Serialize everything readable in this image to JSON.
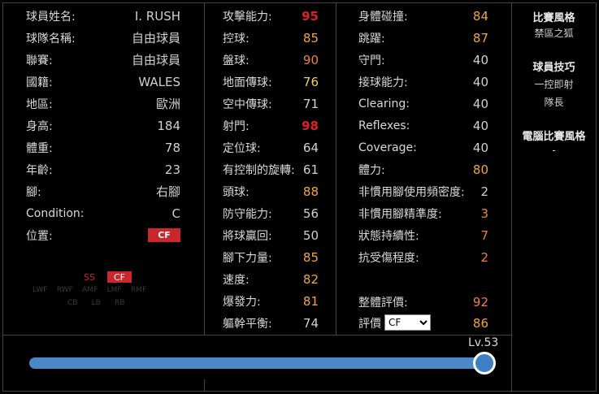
{
  "profile": [
    {
      "label": "球員姓名:",
      "value": "I. RUSH"
    },
    {
      "label": "球隊名稱:",
      "value": "自由球員"
    },
    {
      "label": "聯賽:",
      "value": "自由球員"
    },
    {
      "label": "國籍:",
      "value": "WALES"
    },
    {
      "label": "地區:",
      "value": "歐洲"
    },
    {
      "label": "身高:",
      "value": "184"
    },
    {
      "label": "體重:",
      "value": "78"
    },
    {
      "label": "年齡:",
      "value": "23"
    },
    {
      "label": "腳:",
      "value": "右腳"
    },
    {
      "label": "Condition:",
      "value": "C"
    },
    {
      "label": "位置:",
      "value": "CF"
    }
  ],
  "position_map": {
    "tags": [
      "SS",
      "CF"
    ],
    "faint_row1": [
      "LWF",
      "RWF",
      "AMF",
      "LMF",
      "RMF"
    ],
    "faint_row2": [
      "CB",
      "LB",
      "RB"
    ]
  },
  "stats_col2": [
    {
      "label": "攻擊能力:",
      "value": "95",
      "tier": "top"
    },
    {
      "label": "控球:",
      "value": "85",
      "tier": "high"
    },
    {
      "label": "盤球:",
      "value": "90",
      "tier": "low"
    },
    {
      "label": "地面傳球:",
      "value": "76",
      "tier": "mid"
    },
    {
      "label": "空中傳球:",
      "value": "71",
      "tier": "normal"
    },
    {
      "label": "射門:",
      "value": "98",
      "tier": "top"
    },
    {
      "label": "定位球:",
      "value": "64",
      "tier": "normal"
    },
    {
      "label": "有控制的旋轉:",
      "value": "61",
      "tier": "normal"
    },
    {
      "label": "頭球:",
      "value": "88",
      "tier": "high"
    },
    {
      "label": "防守能力:",
      "value": "56",
      "tier": "normal"
    },
    {
      "label": "將球贏回:",
      "value": "50",
      "tier": "normal"
    },
    {
      "label": "腳下力量:",
      "value": "85",
      "tier": "high"
    },
    {
      "label": "速度:",
      "value": "82",
      "tier": "high"
    },
    {
      "label": "爆發力:",
      "value": "81",
      "tier": "high"
    },
    {
      "label": "軀幹平衡:",
      "value": "74",
      "tier": "normal"
    }
  ],
  "stats_col3": [
    {
      "label": "身體碰撞:",
      "value": "84",
      "tier": "high"
    },
    {
      "label": "跳躍:",
      "value": "87",
      "tier": "high"
    },
    {
      "label": "守門:",
      "value": "40",
      "tier": "normal"
    },
    {
      "label": "接球能力:",
      "value": "40",
      "tier": "normal"
    },
    {
      "label": "Clearing:",
      "value": "40",
      "tier": "normal"
    },
    {
      "label": "Reflexes:",
      "value": "40",
      "tier": "normal"
    },
    {
      "label": "Coverage:",
      "value": "40",
      "tier": "normal"
    },
    {
      "label": "體力:",
      "value": "80",
      "tier": "high"
    },
    {
      "label": "非慣用腳使用頻密度:",
      "value": "2",
      "tier": "normal"
    },
    {
      "label": "非慣用腳精準度:",
      "value": "3",
      "tier": "low"
    },
    {
      "label": "狀態持續性:",
      "value": "7",
      "tier": "low"
    },
    {
      "label": "抗受傷程度:",
      "value": "2",
      "tier": "low"
    }
  ],
  "summary": {
    "overall_label": "整體評價:",
    "overall_value": "92",
    "rating_label": "評價",
    "rating_select": "CF",
    "rating_value": "86"
  },
  "side": {
    "style_title": "比賽風格",
    "style_value": "禁區之狐",
    "skills_title": "球員技巧",
    "skills": [
      "一控即射",
      "隊長"
    ],
    "ai_title": "電腦比賽風格",
    "ai_value": "-"
  },
  "level": {
    "label": "Lv.53",
    "fraction": 1.0
  },
  "colors": {
    "top": "#e02020",
    "high": "#f0a640",
    "mid": "#f0d060",
    "low": "#f08040",
    "normal": "#d0d0d0",
    "slider": "#4a88c6",
    "badge": "#c8272d"
  }
}
